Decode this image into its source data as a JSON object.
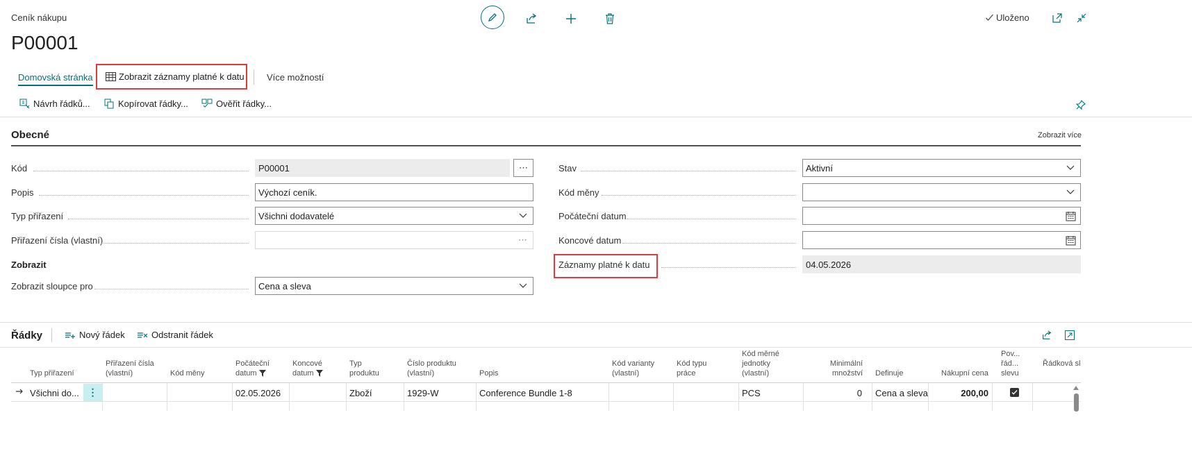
{
  "header": {
    "caption": "Ceník nákupu",
    "title": "P00001",
    "saved_status": "Uloženo"
  },
  "action_bar": {
    "tabs": [
      {
        "label": "Domovská stránka"
      },
      {
        "label": "Zobrazit záznamy platné k datu"
      },
      {
        "label": "Více možností"
      }
    ],
    "actions": [
      {
        "label": "Návrh řádků..."
      },
      {
        "label": "Kopírovat řádky..."
      },
      {
        "label": "Ověřit řádky..."
      }
    ]
  },
  "general": {
    "title": "Obecné",
    "show_more": "Zobrazit více",
    "left_fields": [
      {
        "label": "Kód",
        "value": "P00001"
      },
      {
        "label": "Popis",
        "value": "Výchozí ceník."
      },
      {
        "label": "Typ přiřazení",
        "value": "Všichni dodavatelé"
      },
      {
        "label": "Přiřazení čísla (vlastní)",
        "value": ""
      }
    ],
    "display_group": "Zobrazit",
    "display_field": {
      "label": "Zobrazit sloupce pro",
      "value": "Cena a sleva"
    },
    "right_fields": [
      {
        "label": "Stav",
        "value": "Aktivní"
      },
      {
        "label": "Kód měny",
        "value": ""
      },
      {
        "label": "Počáteční datum",
        "value": ""
      },
      {
        "label": "Koncové datum",
        "value": ""
      },
      {
        "label": "Záznamy platné k datu",
        "value": "04.05.2026"
      }
    ]
  },
  "lines": {
    "title": "Řádky",
    "actions": [
      {
        "label": "Nový řádek"
      },
      {
        "label": "Odstranit řádek"
      }
    ],
    "columns": [
      "Typ přiřazení",
      "Přiřazení čísla (vlastní)",
      "Kód měny",
      "Počáteční datum",
      "Koncové datum",
      "Typ produktu",
      "Číslo produktu (vlastní)",
      "Popis",
      "Kód varianty (vlastní)",
      "Kód typu práce",
      "Kód měrné jednotky (vlastní)",
      "Minimální množství",
      "Definuje",
      "Nákupní cena",
      "Pov... řád... slevu",
      "Řádková sle"
    ],
    "rows": [
      {
        "assign_type": "Všichni do...",
        "assign_no": "",
        "currency": "",
        "start_date": "02.05.2026",
        "end_date": "",
        "product_type": "Zboží",
        "product_no": "1929-W",
        "description": "Conference Bundle 1-8",
        "variant": "",
        "work_type": "",
        "uom": "PCS",
        "min_qty": "0",
        "defines": "Cena a sleva",
        "price": "200,00",
        "allow_discount": true
      }
    ]
  },
  "colors": {
    "accent": "#00707a",
    "highlight": "#e0393e",
    "row_selected": "#c7eef0"
  }
}
